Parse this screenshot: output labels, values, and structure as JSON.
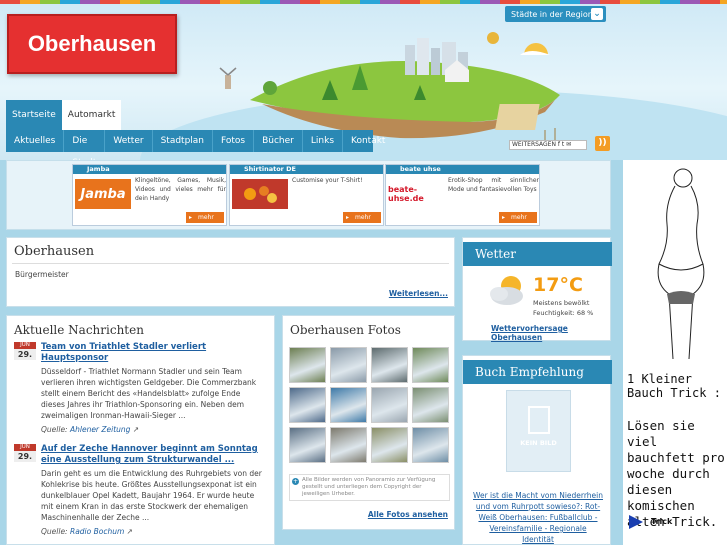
{
  "header": {
    "logo": "Oberhausen",
    "region_button": "Städte in der Region",
    "social_label": "WEITERSAGEN"
  },
  "tabs": [
    "Startseite",
    "Automarkt"
  ],
  "nav": [
    "Aktuelles",
    "Die Stadt",
    "Wetter",
    "Stadtplan",
    "Fotos",
    "Bücher",
    "Links",
    "Kontakt"
  ],
  "ads": [
    {
      "title": "Jamba",
      "logo": "Jamba",
      "logo_color": "#e8731c",
      "text": "Klingeltöne, Games, Musik, Videos und vieles mehr für dein Handy",
      "more": "mehr"
    },
    {
      "title": "Shirtinator DE",
      "logo": "",
      "logo_color": "#c0392b",
      "text": "Customise your T-Shirt!",
      "more": "mehr"
    },
    {
      "title": "beate uhse",
      "logo": "beate-uhse.de",
      "logo_color": "#d4182a",
      "text": "Erotik-Shop mit sinnlicher Mode und fantasievollen Toys",
      "more": "mehr"
    }
  ],
  "intro": {
    "title": "Oberhausen",
    "subtitle": "Bürgermeister",
    "more_link": "Weiterlesen..."
  },
  "news": {
    "title": "Aktuelle Nachrichten",
    "items": [
      {
        "month": "JUN",
        "day": "29.",
        "headline": "Team von Triathlet Stadler verliert Hauptsponsor",
        "text": "Düsseldorf - Triathlet Normann Stadler und sein Team verlieren ihren wichtigsten Geldgeber. Die Commerzbank stellt einem Bericht des «Handelsblatt» zufolge Ende dieses Jahres ihr Triathlon-Sponsoring ein. Neben dem zweimaligen Ironman-Hawaii-Sieger ...",
        "source_label": "Quelle:",
        "source": "Ahlener Zeitung"
      },
      {
        "month": "JUN",
        "day": "29.",
        "headline": "Auf der Zeche Hannover beginnt am Sonntag eine Ausstellung zum Strukturwandel ...",
        "text": "Darin geht es um die Entwicklung des Ruhrgebiets von der Kohlekrise bis heute. Größtes Ausstellungsexponat ist ein dunkelblauer Opel Kadett, Baujahr 1964. Er wurde heute mit einem Kran in das erste Stockwerk der ehemaligen Maschinenhalle der Zeche ...",
        "source_label": "Quelle:",
        "source": "Radio Bochum"
      }
    ]
  },
  "photos": {
    "title": "Oberhausen Fotos",
    "note": "Alle Bilder werden von Panoramio zur Verfügung gestellt und unterliegen dem Copyright der jeweiligen Urheber.",
    "all_link": "Alle Fotos ansehen",
    "tiles": [
      "#6d7f52",
      "#8a9aa8",
      "#5d6b6e",
      "#6f8a5a",
      "#4e6a8a",
      "#3f7aa8",
      "#9aa6b0",
      "#7b8f72",
      "#5a6f84",
      "#7d7a6e",
      "#8a8f66",
      "#6e8ea6"
    ]
  },
  "weather": {
    "title": "Wetter",
    "temperature": "17°C",
    "condition": "Meistens bewölkt",
    "humidity": "Feuchtigkeit: 68 %",
    "link": "Wettervorhersage Oberhausen"
  },
  "book": {
    "title": "Buch Empfehlung",
    "cover_text": "KEIN BILD",
    "link": "Wer ist die Macht vom Niederrhein und vom Ruhrpott sowieso?: Rot-Weiß Oberhausen: Fußballclub - Vereinsfamilie - Regionale Identität"
  },
  "side_ad": {
    "line1": "1 Kleiner Bauch Trick :",
    "line2": "Lösen sie viel bauchfett pro woche durch diesen komischen alten Trick.",
    "cta": "Trick"
  }
}
